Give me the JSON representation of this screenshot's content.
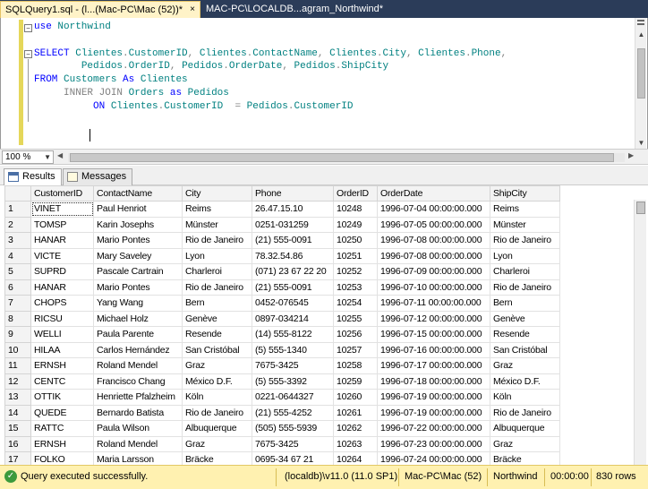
{
  "tabs": [
    {
      "label": "SQLQuery1.sql - (l...(Mac-PC\\Mac (52))*",
      "close": "×"
    },
    {
      "label": "MAC-PC\\LOCALDB...agram_Northwind*"
    }
  ],
  "editor": {
    "lines": [
      [
        {
          "t": "use ",
          "c": "kw"
        },
        {
          "t": "Northwind",
          "c": "id"
        }
      ],
      [],
      [
        {
          "t": "SELECT ",
          "c": "kw"
        },
        {
          "t": "Clientes",
          "c": "id"
        },
        {
          "t": ".",
          "c": "gr"
        },
        {
          "t": "CustomerID",
          "c": "id"
        },
        {
          "t": ", ",
          "c": "gr"
        },
        {
          "t": "Clientes",
          "c": "id"
        },
        {
          "t": ".",
          "c": "gr"
        },
        {
          "t": "ContactName",
          "c": "id"
        },
        {
          "t": ", ",
          "c": "gr"
        },
        {
          "t": "Clientes",
          "c": "id"
        },
        {
          "t": ".",
          "c": "gr"
        },
        {
          "t": "City",
          "c": "id"
        },
        {
          "t": ", ",
          "c": "gr"
        },
        {
          "t": "Clientes",
          "c": "id"
        },
        {
          "t": ".",
          "c": "gr"
        },
        {
          "t": "Phone",
          "c": "id"
        },
        {
          "t": ",",
          "c": "gr"
        }
      ],
      [
        {
          "t": "        "
        },
        {
          "t": "Pedidos",
          "c": "id"
        },
        {
          "t": ".",
          "c": "gr"
        },
        {
          "t": "OrderID",
          "c": "id"
        },
        {
          "t": ", ",
          "c": "gr"
        },
        {
          "t": "Pedidos",
          "c": "id"
        },
        {
          "t": ".",
          "c": "gr"
        },
        {
          "t": "OrderDate",
          "c": "id"
        },
        {
          "t": ", ",
          "c": "gr"
        },
        {
          "t": "Pedidos",
          "c": "id"
        },
        {
          "t": ".",
          "c": "gr"
        },
        {
          "t": "ShipCity",
          "c": "id"
        }
      ],
      [
        {
          "t": "FROM ",
          "c": "kw"
        },
        {
          "t": "Customers ",
          "c": "id"
        },
        {
          "t": "As ",
          "c": "kw"
        },
        {
          "t": "Clientes",
          "c": "id"
        }
      ],
      [
        {
          "t": "     "
        },
        {
          "t": "INNER JOIN ",
          "c": "gr"
        },
        {
          "t": "Orders ",
          "c": "id"
        },
        {
          "t": "as ",
          "c": "kw"
        },
        {
          "t": "Pedidos",
          "c": "id"
        }
      ],
      [
        {
          "t": "          "
        },
        {
          "t": "ON ",
          "c": "kw"
        },
        {
          "t": "Clientes",
          "c": "id"
        },
        {
          "t": ".",
          "c": "gr"
        },
        {
          "t": "CustomerID  ",
          "c": "id"
        },
        {
          "t": "= ",
          "c": "gr"
        },
        {
          "t": "Pedidos",
          "c": "id"
        },
        {
          "t": ".",
          "c": "gr"
        },
        {
          "t": "CustomerID",
          "c": "id"
        }
      ],
      []
    ]
  },
  "zoom": {
    "value": "100 %"
  },
  "results_tabs": {
    "results": "Results",
    "messages": "Messages"
  },
  "grid": {
    "columns": [
      "CustomerID",
      "ContactName",
      "City",
      "Phone",
      "OrderID",
      "OrderDate",
      "ShipCity"
    ],
    "rows": [
      [
        "1",
        "VINET",
        "Paul Henriot",
        "Reims",
        "26.47.15.10",
        "10248",
        "1996-07-04 00:00:00.000",
        "Reims"
      ],
      [
        "2",
        "TOMSP",
        "Karin Josephs",
        "Münster",
        "0251-031259",
        "10249",
        "1996-07-05 00:00:00.000",
        "Münster"
      ],
      [
        "3",
        "HANAR",
        "Mario Pontes",
        "Rio de Janeiro",
        "(21) 555-0091",
        "10250",
        "1996-07-08 00:00:00.000",
        "Rio de Janeiro"
      ],
      [
        "4",
        "VICTE",
        "Mary Saveley",
        "Lyon",
        "78.32.54.86",
        "10251",
        "1996-07-08 00:00:00.000",
        "Lyon"
      ],
      [
        "5",
        "SUPRD",
        "Pascale Cartrain",
        "Charleroi",
        "(071) 23 67 22 20",
        "10252",
        "1996-07-09 00:00:00.000",
        "Charleroi"
      ],
      [
        "6",
        "HANAR",
        "Mario Pontes",
        "Rio de Janeiro",
        "(21) 555-0091",
        "10253",
        "1996-07-10 00:00:00.000",
        "Rio de Janeiro"
      ],
      [
        "7",
        "CHOPS",
        "Yang Wang",
        "Bern",
        "0452-076545",
        "10254",
        "1996-07-11 00:00:00.000",
        "Bern"
      ],
      [
        "8",
        "RICSU",
        "Michael Holz",
        "Genève",
        "0897-034214",
        "10255",
        "1996-07-12 00:00:00.000",
        "Genève"
      ],
      [
        "9",
        "WELLI",
        "Paula Parente",
        "Resende",
        "(14) 555-8122",
        "10256",
        "1996-07-15 00:00:00.000",
        "Resende"
      ],
      [
        "10",
        "HILAA",
        "Carlos Hernández",
        "San Cristóbal",
        "(5) 555-1340",
        "10257",
        "1996-07-16 00:00:00.000",
        "San Cristóbal"
      ],
      [
        "11",
        "ERNSH",
        "Roland Mendel",
        "Graz",
        "7675-3425",
        "10258",
        "1996-07-17 00:00:00.000",
        "Graz"
      ],
      [
        "12",
        "CENTC",
        "Francisco Chang",
        "México D.F.",
        "(5) 555-3392",
        "10259",
        "1996-07-18 00:00:00.000",
        "México D.F."
      ],
      [
        "13",
        "OTTIK",
        "Henriette Pfalzheim",
        "Köln",
        "0221-0644327",
        "10260",
        "1996-07-19 00:00:00.000",
        "Köln"
      ],
      [
        "14",
        "QUEDE",
        "Bernardo Batista",
        "Rio de Janeiro",
        "(21) 555-4252",
        "10261",
        "1996-07-19 00:00:00.000",
        "Rio de Janeiro"
      ],
      [
        "15",
        "RATTC",
        "Paula Wilson",
        "Albuquerque",
        "(505) 555-5939",
        "10262",
        "1996-07-22 00:00:00.000",
        "Albuquerque"
      ],
      [
        "16",
        "ERNSH",
        "Roland Mendel",
        "Graz",
        "7675-3425",
        "10263",
        "1996-07-23 00:00:00.000",
        "Graz"
      ],
      [
        "17",
        "FOLKO",
        "Maria Larsson",
        "Bräcke",
        "0695-34 67 21",
        "10264",
        "1996-07-24 00:00:00.000",
        "Bräcke"
      ]
    ]
  },
  "status": {
    "message": "Query executed successfully.",
    "server": "(localdb)\\v11.0 (11.0 SP1)",
    "user": "Mac-PC\\Mac (52)",
    "database": "Northwind",
    "elapsed": "00:00:00",
    "rows": "830 rows"
  }
}
